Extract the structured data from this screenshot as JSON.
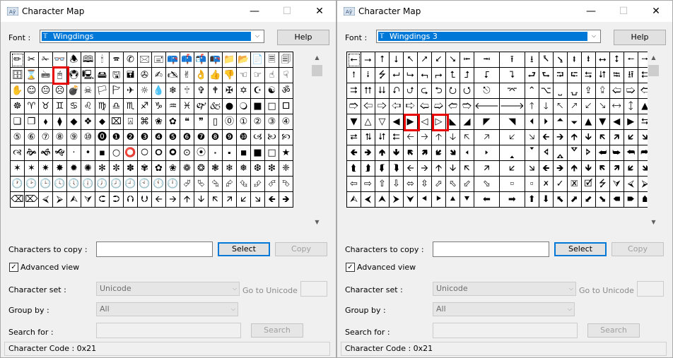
{
  "windows": [
    {
      "title": "Character Map",
      "font_label": "Font :",
      "font_value": "Wingdings",
      "help_label": "Help",
      "highlight_row": 1,
      "highlight_cols": [
        3
      ],
      "focus_cell": [
        0,
        0
      ],
      "grid": [
        [
          "✏",
          "✂",
          "✁",
          "👓",
          "🕭",
          "🕮",
          "🕯",
          "🕿",
          "✆",
          "🖂",
          "🖃",
          "📪",
          "📫",
          "📬",
          "📭",
          "📁",
          "📂",
          "📄",
          "🗏",
          "🗐"
        ],
        [
          "🗄",
          "⌛",
          "🖮",
          "🖰",
          "🖲",
          "🖳",
          "🖴",
          "🖫",
          "🖬",
          "✇",
          "✍",
          "🖎",
          "✌",
          "👌",
          "👍",
          "👎",
          "☜",
          "☞",
          "☝",
          "☟"
        ],
        [
          "✋",
          "☺",
          "😐",
          "☹",
          "💣",
          "☠",
          "🏳",
          "🏱",
          "✈",
          "☼",
          "💧",
          "❄",
          "🕆",
          "✞",
          "🕈",
          "✠",
          "✡",
          "☪",
          "☯",
          "ॐ"
        ],
        [
          "☸",
          "♈",
          "♉",
          "♊",
          "♋",
          "♌",
          "♍",
          "♎",
          "♏",
          "♐",
          "♑",
          "♒",
          "♓",
          "🙰",
          "🙵",
          "●",
          "🔾",
          "■",
          "□",
          "🞐"
        ],
        [
          "❑",
          "❒",
          "⬧",
          "⧫",
          "◆",
          "❖",
          "⬥",
          "⌧",
          "⍓",
          "⌘",
          "❀",
          "✿",
          "❝",
          "❞",
          "▯",
          "⓪",
          "①",
          "②",
          "③",
          "④"
        ],
        [
          "⑤",
          "⑥",
          "⑦",
          "⑧",
          "⑨",
          "⑩",
          "⓿",
          "❶",
          "❷",
          "❸",
          "❹",
          "❺",
          "❻",
          "❼",
          "❽",
          "❾",
          "❿",
          "🙢",
          "🙠",
          "🙡"
        ],
        [
          "🙣",
          "🙞",
          "🙜",
          "🙝",
          "·",
          "•",
          "▪",
          "○",
          "⭕",
          "🞅",
          "🞇",
          "🞉",
          "⊙",
          "⦿",
          "🞌",
          "🞍",
          "◾",
          "■",
          "□",
          "★"
        ],
        [
          "✶",
          "✶",
          "✷",
          "✸",
          "✹",
          "✺",
          "✻",
          "✼",
          "✽",
          "✾",
          "✿",
          "❀",
          "❁",
          "❂",
          "❃",
          "❄",
          "❅",
          "❆",
          "❇",
          "❈"
        ],
        [
          "🕐",
          "🕑",
          "🕒",
          "🕓",
          "🕔",
          "🕕",
          "🕖",
          "🕗",
          "🕘",
          "🕙",
          "🕚",
          "🕛",
          "⮰",
          "⮱",
          "⮲",
          "⮳",
          "⮴",
          "⮵",
          "⮶",
          "⮷"
        ],
        [
          "⌫",
          "⌦",
          "⮘",
          "⮚",
          "⮙",
          "⮛",
          "⮈",
          "⮊",
          "⮉",
          "⮋",
          "🡨",
          "🡪",
          "🡩",
          "🡫",
          "🡬",
          "🡭",
          "🡯",
          "🡮",
          "🡸",
          "🡺"
        ]
      ],
      "chars_to_copy_label": "Characters to copy :",
      "chars_to_copy_value": "",
      "select_label": "Select",
      "copy_label": "Copy",
      "advanced_view_label": "Advanced view",
      "advanced_view_checked": "✓",
      "character_set_label": "Character set :",
      "character_set_value": "Unicode",
      "goto_unicode_label": "Go to Unicode :",
      "group_by_label": "Group by :",
      "group_by_value": "All",
      "search_for_label": "Search for :",
      "search_label": "Search",
      "status_text": "Character Code : 0x21"
    },
    {
      "title": "Character Map",
      "font_label": "Font :",
      "font_value": "Wingdings 3",
      "help_label": "Help",
      "highlight_row": 4,
      "highlight_cols": [
        4,
        6
      ],
      "focus_cell": [
        0,
        0
      ],
      "grid": [
        [
          "⭠",
          "⭢",
          "⭡",
          "⭣",
          "⭦",
          "⭧",
          "⭩",
          "⭨",
          "⭰",
          "⭲",
          "⭱",
          "⭳",
          "⭶",
          "⭸",
          "⭻",
          "⭽",
          "⭤",
          "⭥",
          "⭪",
          "⭬"
        ],
        [
          "⭫",
          "⭭",
          "⭍",
          "⮠",
          "⮡",
          "⮢",
          "⮣",
          "⮤",
          "⮥",
          "⮦",
          "⮧",
          "⮐",
          "⮑",
          "⮒",
          "⮓",
          "⮀",
          "⮃",
          "⭾",
          "⭿",
          "⮄"
        ],
        [
          "⮆",
          "⮅",
          "⮇",
          "⮏",
          "⮍",
          "⮎",
          "⮌",
          "⭮",
          "⭯",
          "⎋",
          "⌤",
          "⌃",
          "⌥",
          "⎵",
          "⍽",
          "⇪",
          "⮸",
          "🢠",
          "🢡",
          "🢢"
        ],
        [
          "🢣",
          "🢤",
          "🢥",
          "🢦",
          "🢧",
          "🢨",
          "🢩",
          "🢪",
          "🢫",
          "🡐",
          "🡒",
          "🡑",
          "🡓",
          "🡔",
          "🡕",
          "🡗",
          "🡖",
          "🡘",
          "🡙",
          "▲"
        ],
        [
          "▼",
          "△",
          "▽",
          "◀",
          "▶",
          "◁",
          "▷",
          "◣",
          "◢",
          "◤",
          "◥",
          "🞀",
          "🞂",
          "🞁",
          "🞃",
          "▲",
          "▼",
          "◀",
          "▶",
          "⮀"
        ],
        [
          "⮂",
          "⮁",
          "⮃",
          "⮄",
          "🡠",
          "🡢",
          "🡡",
          "🡣",
          "🡤",
          "🡥",
          "🡧",
          "🡦",
          "🡰",
          "🡲",
          "🡱",
          "🡳",
          "🡴",
          "🡵",
          "🡷",
          "🡶"
        ],
        [
          "🢀",
          "🢂",
          "🢁",
          "🢃",
          "🢄",
          "🢅",
          "🢇",
          "🢆",
          "🢐",
          "🢒",
          "🢑",
          "🢓",
          "🢔",
          "🢕",
          "🢗",
          "🢖",
          "⮨",
          "⮩",
          "⮪",
          "⮫"
        ],
        [
          "⮬",
          "⮭",
          "⮮",
          "⮯",
          "🡨",
          "🡪",
          "🡩",
          "🡫",
          "🡬",
          "🡭",
          "🡯",
          "🡮",
          "🡸",
          "🡺",
          "🡹",
          "🡻",
          "🡼",
          "🡽",
          "🡿",
          "🡾"
        ],
        [
          "⇦",
          "⇨",
          "⇧",
          "⇩",
          "⬄",
          "⇳",
          "⬀",
          "⬁",
          "⬃",
          "⬂",
          "🢬",
          "🢭",
          "🗶",
          "✓",
          "🗷",
          "🗹",
          "⭍",
          "⮛",
          "⮘",
          "⮚"
        ],
        [
          "⮙",
          "⮜",
          "⮝",
          "⮞",
          "⮟",
          "⯇",
          "⯈",
          "⯅",
          "⯆",
          "⬅",
          "➡",
          "⬆",
          "⬇",
          "⬉",
          "⬈",
          "⬋",
          "⬊",
          "🠴",
          "🠶",
          "🠵"
        ]
      ],
      "chars_to_copy_label": "Characters to copy :",
      "chars_to_copy_value": "",
      "select_label": "Select",
      "copy_label": "Copy",
      "advanced_view_label": "Advanced view",
      "advanced_view_checked": "✓",
      "character_set_label": "Character set :",
      "character_set_value": "Unicode",
      "goto_unicode_label": "Go to Unicode :",
      "group_by_label": "Group by :",
      "group_by_value": "All",
      "search_for_label": "Search for :",
      "search_label": "Search",
      "status_text": "Character Code : 0x21"
    }
  ],
  "icons": {
    "minimize": "—",
    "maximize": "☐",
    "close": "✕",
    "combo_arrow": "⌵",
    "scroll_up": "▲",
    "scroll_down": "▼"
  },
  "colors": {
    "selection": "#0078d7",
    "highlight_box": "#e60000"
  }
}
